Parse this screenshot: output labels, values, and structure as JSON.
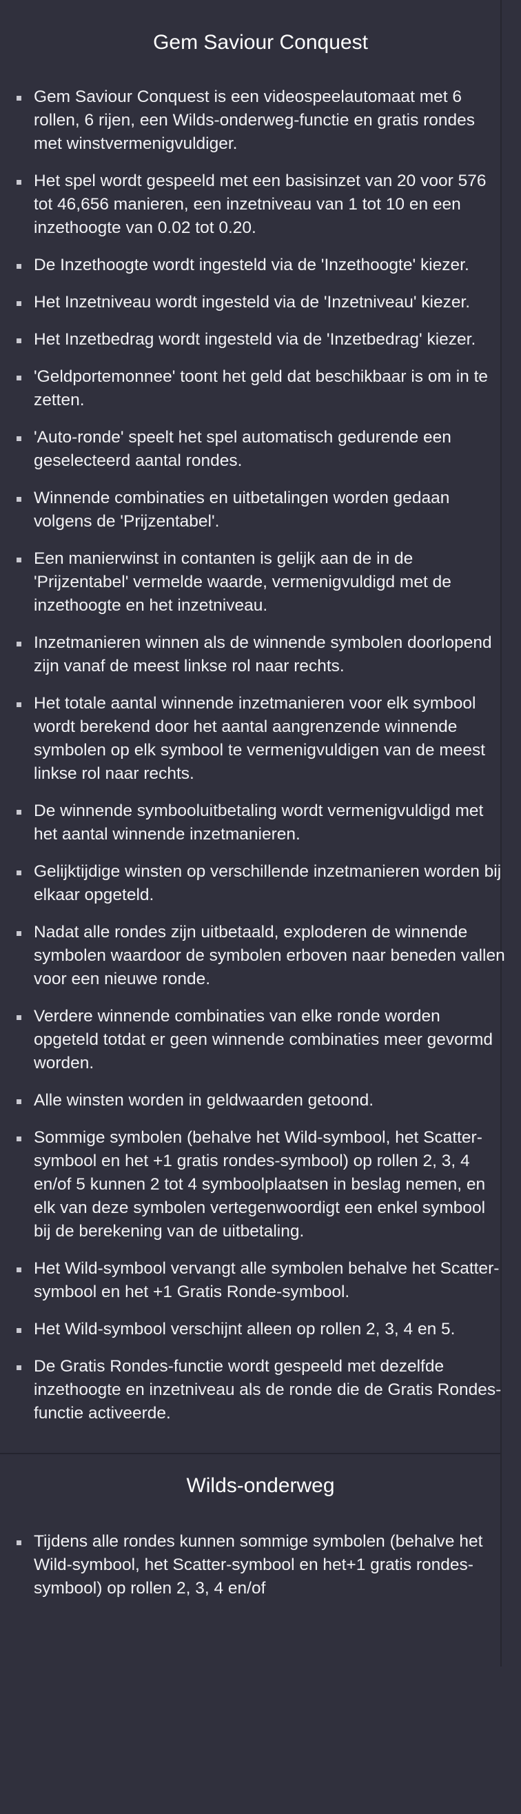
{
  "rules_section": {
    "title": "Gem Saviour Conquest",
    "items": [
      "Gem Saviour Conquest is een videospeelautomaat met 6 rollen, 6 rijen, een Wilds-onderweg-functie en gratis rondes met winstvermenigvuldiger.",
      "Het spel wordt gespeeld met een basisinzet van 20 voor 576 tot 46,656 manieren, een inzetniveau van 1 tot 10 en een inzethoogte van 0.02 tot 0.20.",
      "De Inzethoogte wordt ingesteld via de 'Inzethoogte' kiezer.",
      "Het Inzetniveau wordt ingesteld via de 'Inzetniveau' kiezer.",
      "Het Inzetbedrag wordt ingesteld via de 'Inzetbedrag' kiezer.",
      "'Geldportemonnee' toont het geld dat beschikbaar is om in te zetten.",
      "'Auto-ronde' speelt het spel automatisch gedurende een geselecteerd aantal rondes.",
      "Winnende combinaties en uitbetalingen worden gedaan volgens de 'Prijzentabel'.",
      "Een manierwinst in contanten is gelijk aan de in de 'Prijzentabel' vermelde waarde, vermenigvuldigd met de inzethoogte en het inzetniveau.",
      "Inzetmanieren winnen als de winnende symbolen doorlopend zijn vanaf de meest linkse rol naar rechts.",
      "Het totale aantal winnende inzetmanieren voor elk symbool wordt berekend door het aantal aangrenzende winnende symbolen op elk symbool te vermenigvuldigen van de meest linkse rol naar rechts.",
      "De winnende symbooluitbetaling wordt vermenigvuldigd met het aantal winnende inzetmanieren.",
      "Gelijktijdige winsten op verschillende inzetmanieren worden bij elkaar opgeteld.",
      "Nadat alle rondes zijn uitbetaald, exploderen de winnende symbolen waardoor de symbolen erboven naar beneden vallen voor een nieuwe ronde.",
      "Verdere winnende combinaties van elke ronde worden opgeteld totdat er geen winnende combinaties meer gevormd worden.",
      "Alle winsten worden in geldwaarden getoond.",
      "Sommige symbolen (behalve het Wild-symbool, het Scatter-symbool en het +1 gratis rondes-symbool) op rollen 2, 3, 4 en/of 5 kunnen 2 tot 4 symboolplaatsen in beslag nemen, en elk van deze symbolen vertegenwoordigt een enkel symbool bij de berekening van de uitbetaling.",
      "Het Wild-symbool vervangt alle symbolen behalve het Scatter-symbool en het +1 Gratis Ronde-symbool.",
      "Het Wild-symbool verschijnt alleen op rollen 2, 3, 4 en 5.",
      "De Gratis Rondes-functie wordt gespeeld met dezelfde inzethoogte en inzetniveau als de ronde die de Gratis Rondes-functie activeerde."
    ]
  },
  "wilds_section": {
    "title": "Wilds-onderweg",
    "items": [
      "Tijdens alle rondes kunnen sommige symbolen (behalve het Wild-symbool, het Scatter-symbool en het+1 gratis rondes-symbool) op rollen 2, 3, 4 en/of"
    ]
  }
}
